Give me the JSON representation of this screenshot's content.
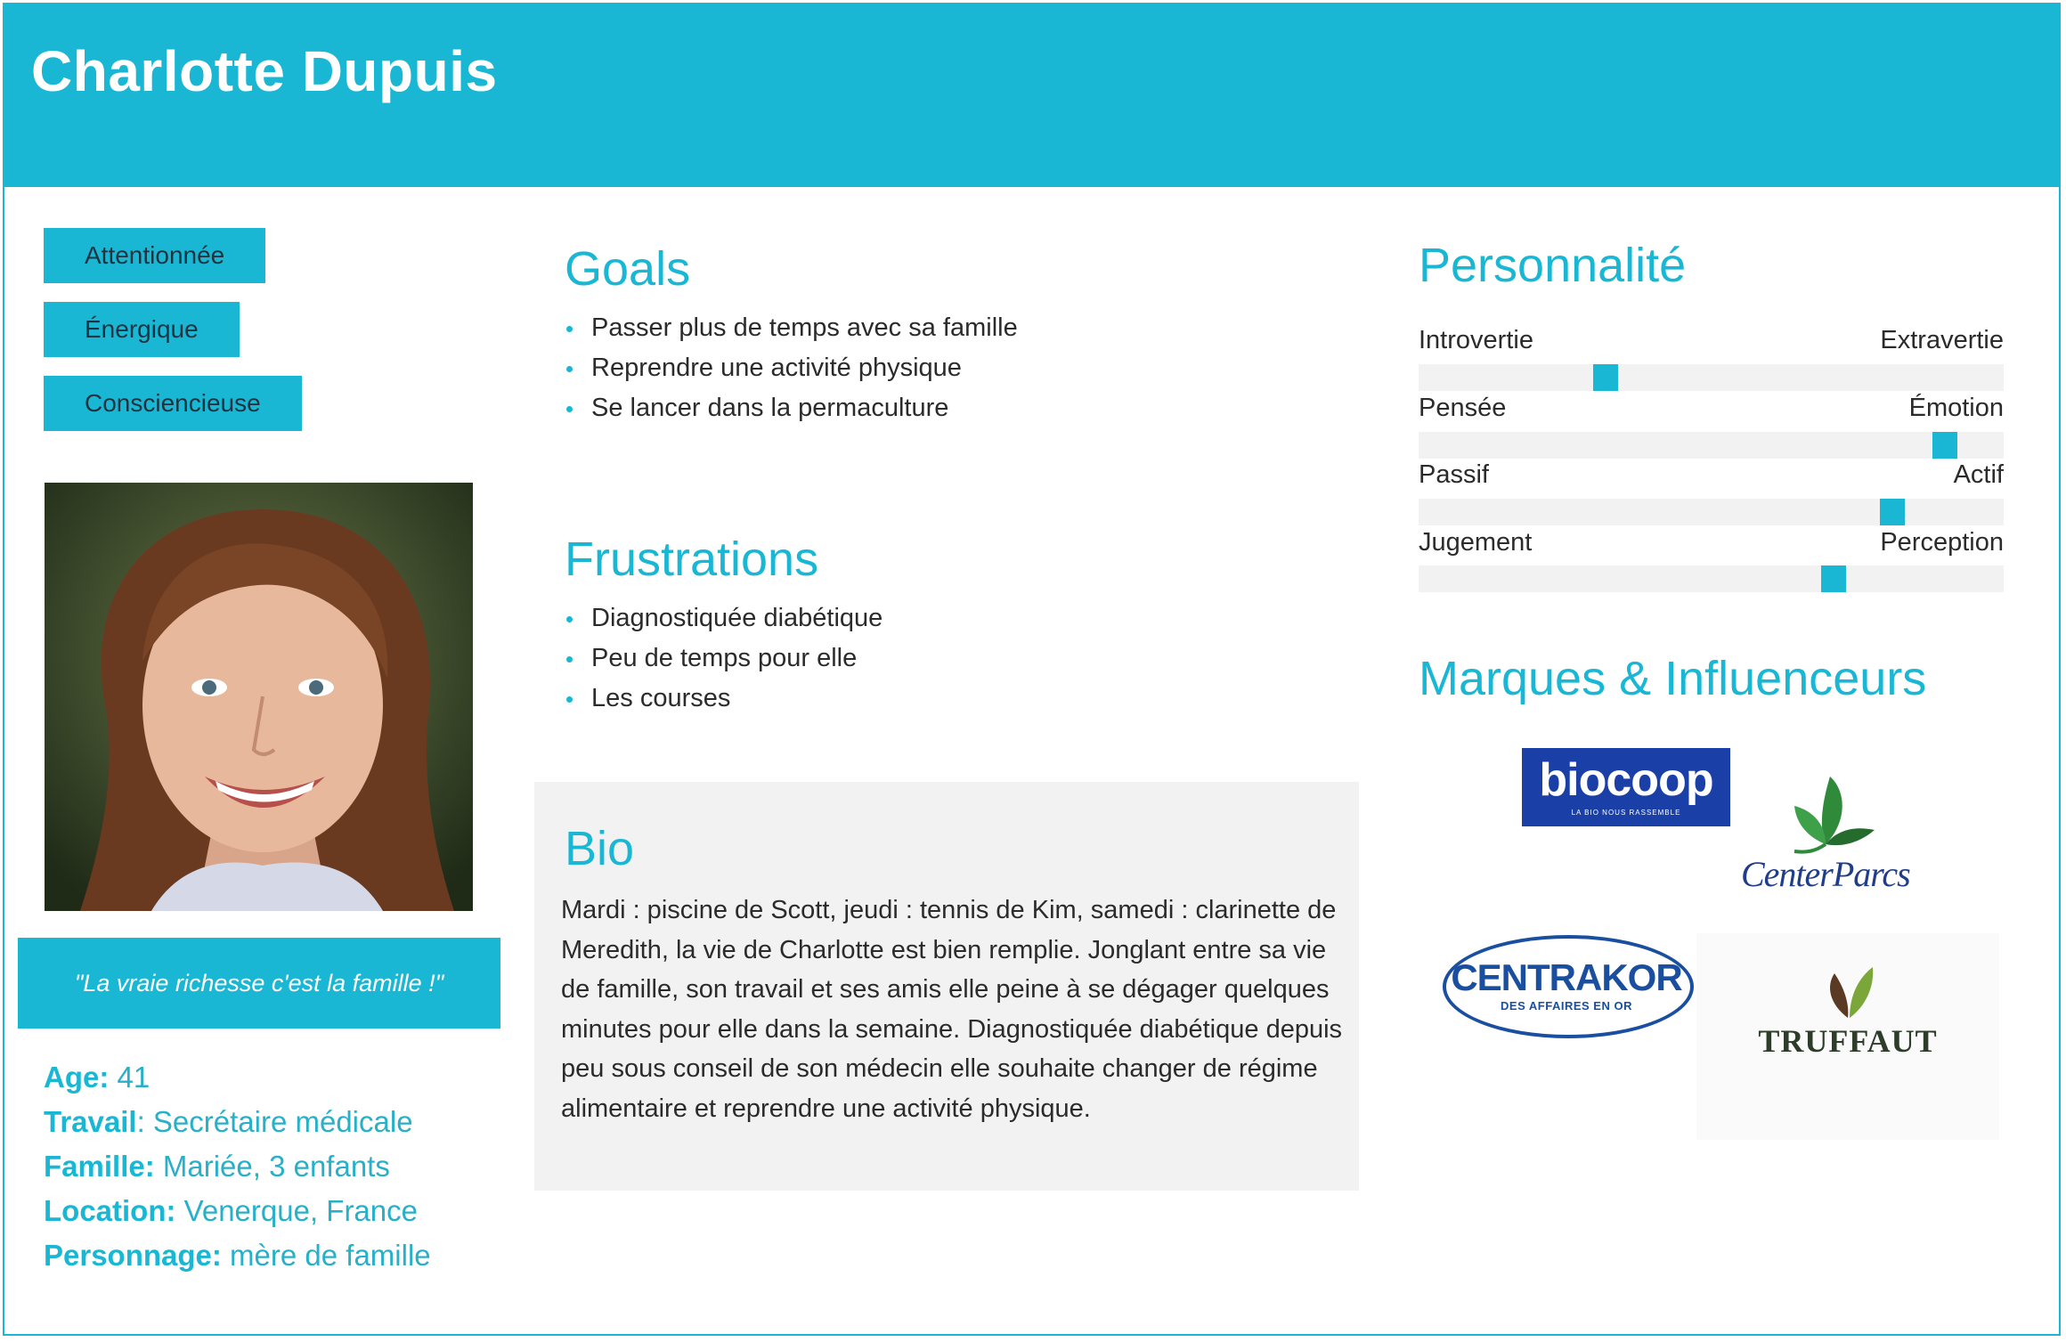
{
  "header": {
    "name": "Charlotte Dupuis"
  },
  "tags": [
    "Attentionnée",
    "Énergique",
    "Consciencieuse"
  ],
  "photo": {
    "alt_icon": "portrait-photo"
  },
  "quote": "\"La vraie richesse c'est la famille !\"",
  "facts": [
    {
      "key": "Age:",
      "value": " 41"
    },
    {
      "key": "Travail",
      "value": ": Secrétaire médicale"
    },
    {
      "key": "Famille:",
      "value": " Mariée, 3 enfants"
    },
    {
      "key": "Location:",
      "value": " Venerque, France"
    },
    {
      "key": "Personnage:",
      "value": " mère de famille"
    }
  ],
  "goals": {
    "title": "Goals",
    "items": [
      "Passer plus de temps avec sa famille",
      "Reprendre une activité physique",
      "Se lancer dans la permaculture"
    ]
  },
  "frustrations": {
    "title": "Frustrations",
    "items": [
      "Diagnostiquée diabétique",
      "Peu de temps pour elle",
      "Les courses"
    ]
  },
  "bio": {
    "title": "Bio",
    "text": "Mardi : piscine de Scott, jeudi : tennis de Kim, samedi : clarinette de Meredith, la vie de Charlotte est bien remplie. Jonglant entre sa vie de famille, son travail et ses amis elle peine à se dégager quelques minutes pour elle dans la semaine. Diagnostiquée diabétique depuis peu sous conseil de son médecin elle souhaite changer de régime alimentaire et reprendre une activité physique."
  },
  "personality": {
    "title": "Personnalité",
    "traits": [
      {
        "left": "Introvertie",
        "right": "Extravertie",
        "level": 0.32
      },
      {
        "left": "Pensée",
        "right": "Émotion",
        "level": 0.9
      },
      {
        "left": "Passif",
        "right": "Actif",
        "level": 0.81
      },
      {
        "left": "Jugement",
        "right": "Perception",
        "level": 0.71
      }
    ]
  },
  "brands": {
    "title": "Marques & Influenceurs",
    "biocoop": {
      "name": "biocoop",
      "tagline": "LA BIO NOUS RASSEMBLE"
    },
    "centerparcs": {
      "name": "CenterParcs"
    },
    "centrakor": {
      "name": "CENTRAKOR",
      "tagline": "DES AFFAIRES EN OR"
    },
    "truffaut": {
      "name": "TRUFFAUT"
    }
  },
  "colors": {
    "accent": "#1ab7d4",
    "panel": "#f2f2f2",
    "text": "#2b2b2b"
  }
}
